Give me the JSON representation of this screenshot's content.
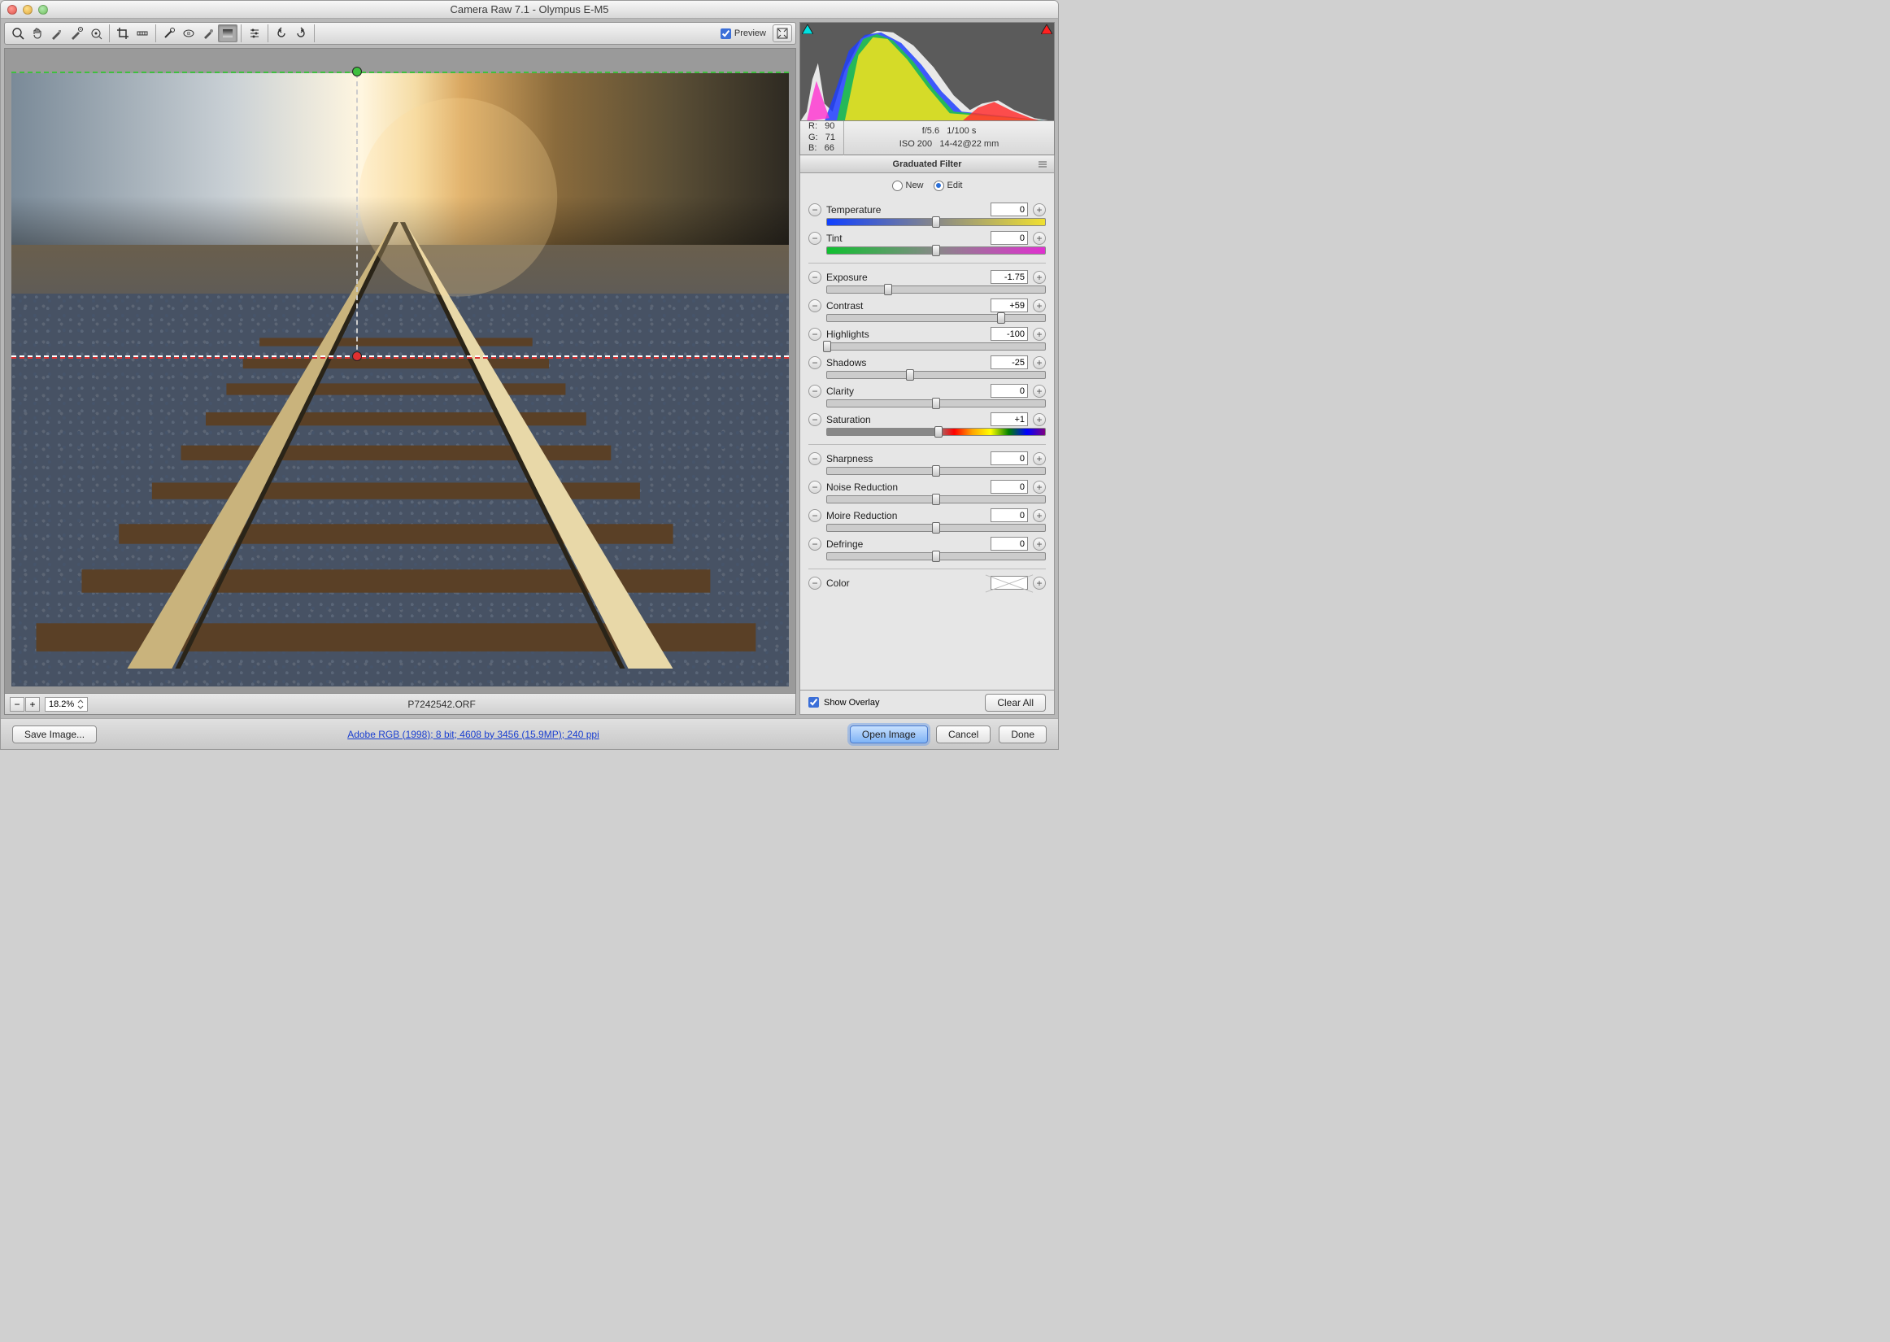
{
  "window": {
    "title": "Camera Raw 7.1  -  Olympus E-M5"
  },
  "toolbar": {
    "tools": [
      "zoom",
      "hand",
      "eyedrop-white",
      "eyedrop-color",
      "target-adjust",
      "crop",
      "straighten",
      "spot",
      "redeye",
      "adjustment-brush",
      "graduated-filter",
      "preferences",
      "rotate-ccw",
      "rotate-cw"
    ],
    "preview_label": "Preview",
    "preview_checked": true
  },
  "image": {
    "filename": "P7242542.ORF",
    "zoom": "18.2%"
  },
  "rgb": {
    "r_label": "R:",
    "g_label": "G:",
    "b_label": "B:",
    "r": "90",
    "g": "71",
    "b": "66"
  },
  "exif": {
    "aperture": "f/5.6",
    "shutter": "1/100 s",
    "iso": "ISO 200",
    "lens": "14-42@22 mm"
  },
  "panel": {
    "title": "Graduated Filter",
    "mode_new": "New",
    "mode_edit": "Edit",
    "mode_selected": "edit"
  },
  "sliders": {
    "temperature": {
      "label": "Temperature",
      "value": "0",
      "pos": 50
    },
    "tint": {
      "label": "Tint",
      "value": "0",
      "pos": 50
    },
    "exposure": {
      "label": "Exposure",
      "value": "-1.75",
      "pos": 28
    },
    "contrast": {
      "label": "Contrast",
      "value": "+59",
      "pos": 80
    },
    "highlights": {
      "label": "Highlights",
      "value": "-100",
      "pos": 0
    },
    "shadows": {
      "label": "Shadows",
      "value": "-25",
      "pos": 38
    },
    "clarity": {
      "label": "Clarity",
      "value": "0",
      "pos": 50
    },
    "saturation": {
      "label": "Saturation",
      "value": "+1",
      "pos": 51
    },
    "sharpness": {
      "label": "Sharpness",
      "value": "0",
      "pos": 50
    },
    "noise": {
      "label": "Noise Reduction",
      "value": "0",
      "pos": 50
    },
    "moire": {
      "label": "Moire Reduction",
      "value": "0",
      "pos": 50
    },
    "defringe": {
      "label": "Defringe",
      "value": "0",
      "pos": 50
    },
    "color": {
      "label": "Color"
    }
  },
  "overlay": {
    "label": "Show Overlay",
    "checked": true,
    "clear": "Clear All"
  },
  "footer": {
    "save": "Save Image...",
    "link": "Adobe RGB (1998); 8 bit; 4608 by 3456 (15.9MP); 240 ppi",
    "open": "Open Image",
    "cancel": "Cancel",
    "done": "Done"
  }
}
